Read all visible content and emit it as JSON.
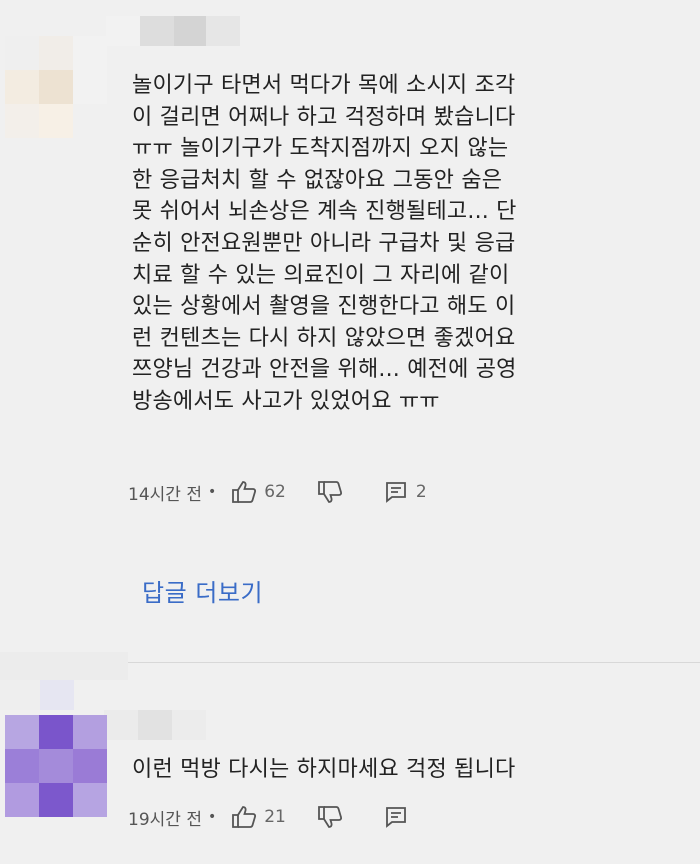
{
  "comments": [
    {
      "text_lines": [
        "놀이기구 타면서 먹다가 목에 소시지 조각",
        "이 걸리면 어쩌나 하고 걱정하며 봤습니다",
        "ㅠㅠ 놀이기구가 도착지점까지 오지 않는",
        "한 응급처치 할 수 없잖아요 그동안 숨은",
        "못 쉬어서 뇌손상은 계속 진행될테고... 단",
        "순히 안전요원뿐만 아니라 구급차 및 응급",
        "치료 할 수 있는 의료진이 그 자리에 같이",
        "있는 상황에서 촬영을 진행한다고 해도 이",
        "런 컨텐츠는 다시 하지 않았으면 좋겠어요",
        "쯔양님 건강과 안전을 위해... 예전에 공영",
        "방송에서도 사고가 있었어요 ㅠㅠ"
      ],
      "time": "14시간 전",
      "separator": "•",
      "likes": "62",
      "replies": "2",
      "icons": {
        "like": "thumbs-up-icon",
        "dislike": "thumbs-down-icon",
        "reply": "reply-icon"
      }
    },
    {
      "text_lines": [
        "이런 먹방 다시는 하지마세요 걱정 됩니다"
      ],
      "time": "19시간 전",
      "separator": "•",
      "likes": "21",
      "replies": "",
      "icons": {
        "like": "thumbs-up-icon",
        "dislike": "thumbs-down-icon",
        "reply": "reply-icon"
      }
    }
  ],
  "more_replies_label": "답글 더보기",
  "colors": {
    "background": "#f0f0f0",
    "text": "#222222",
    "meta": "#555555",
    "link": "#3a6cc7",
    "avatar1": [
      "#efefef",
      "#f1ede8",
      "#f2f2f2",
      "#f3ece1",
      "#ede2d2",
      "#f2f2f2",
      "#f3efea",
      "#f7f0e6",
      "#f0f0f0"
    ],
    "avatar2": [
      "#b7a6e2",
      "#7a55cb",
      "#b39fe0",
      "#9b7fd8",
      "#a48bda",
      "#9a7bd6",
      "#b19be0",
      "#7c58cc",
      "#b6a4e2"
    ],
    "blur_gray": [
      "#f3f3f3",
      "#e0e0e0",
      "#d2d2d2",
      "#e7e7e7"
    ]
  }
}
